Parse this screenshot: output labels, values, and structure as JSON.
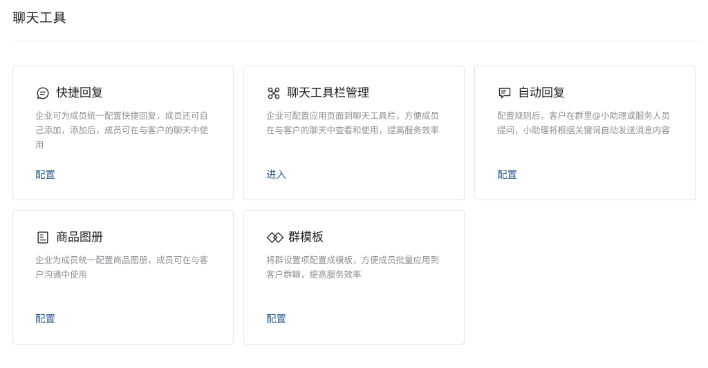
{
  "page": {
    "title": "聊天工具"
  },
  "cards": [
    {
      "icon": "quick-reply-icon",
      "title": "快捷回复",
      "description": "企业可为成员统一配置快捷回复，成员还可自己添加，添加后，成员可在与客户的聊天中使用",
      "action": "配置"
    },
    {
      "icon": "toolbar-icon",
      "title": "聊天工具栏管理",
      "description": "企业可配置应用页面到聊天工具栏，方便成员在与客户的聊天中查看和使用，提高服务效率",
      "action": "进入"
    },
    {
      "icon": "auto-reply-icon",
      "title": "自动回复",
      "description": "配置规则后，客户在群里@小助理或服务人员提问，小助理将根据关键词自动发送消息内容",
      "action": "配置"
    },
    {
      "icon": "product-album-icon",
      "title": "商品图册",
      "description": "企业为成员统一配置商品图册，成员可在与客户沟通中使用",
      "action": "配置"
    },
    {
      "icon": "group-template-icon",
      "title": "群模板",
      "description": "将群设置项配置成模板，方便成员批量应用到客户群聊，提高服务效率",
      "action": "配置"
    }
  ]
}
